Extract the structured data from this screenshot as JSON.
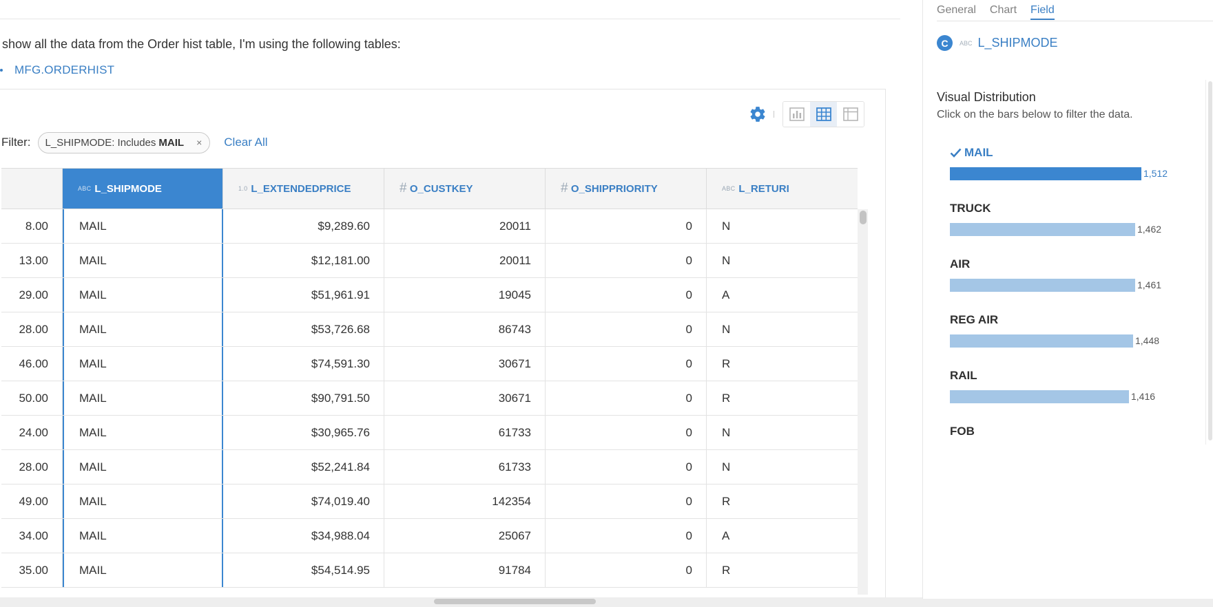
{
  "message": {
    "text": "show all the data from the Order hist table, I'm using the following tables:",
    "table_link": "MFG.ORDERHIST"
  },
  "toolbar": {
    "settings_icon": "gear-icon",
    "views": [
      "chart-view-icon",
      "table-view-icon",
      "pivot-view-icon"
    ],
    "active_view": "table"
  },
  "filter": {
    "label": "Filter:",
    "chip_field": "L_SHIPMODE: Includes",
    "chip_value": "MAIL",
    "chip_remove": "×",
    "clear_all": "Clear All"
  },
  "table": {
    "columns": [
      {
        "type": "",
        "name": ""
      },
      {
        "type": "ABC",
        "name": "L_SHIPMODE"
      },
      {
        "type": "1.0",
        "name": "L_EXTENDEDPRICE"
      },
      {
        "type": "#",
        "name": "O_CUSTKEY"
      },
      {
        "type": "#",
        "name": "O_SHIPPRIORITY"
      },
      {
        "type": "ABC",
        "name": "L_RETURI"
      }
    ],
    "rows": [
      [
        "8.00",
        "MAIL",
        "$9,289.60",
        "20011",
        "0",
        "N"
      ],
      [
        "13.00",
        "MAIL",
        "$12,181.00",
        "20011",
        "0",
        "N"
      ],
      [
        "29.00",
        "MAIL",
        "$51,961.91",
        "19045",
        "0",
        "A"
      ],
      [
        "28.00",
        "MAIL",
        "$53,726.68",
        "86743",
        "0",
        "N"
      ],
      [
        "46.00",
        "MAIL",
        "$74,591.30",
        "30671",
        "0",
        "R"
      ],
      [
        "50.00",
        "MAIL",
        "$90,791.50",
        "30671",
        "0",
        "R"
      ],
      [
        "24.00",
        "MAIL",
        "$30,965.76",
        "61733",
        "0",
        "N"
      ],
      [
        "28.00",
        "MAIL",
        "$52,241.84",
        "61733",
        "0",
        "N"
      ],
      [
        "49.00",
        "MAIL",
        "$74,019.40",
        "142354",
        "0",
        "R"
      ],
      [
        "34.00",
        "MAIL",
        "$34,988.04",
        "25067",
        "0",
        "A"
      ],
      [
        "35.00",
        "MAIL",
        "$54,514.95",
        "91784",
        "0",
        "R"
      ]
    ]
  },
  "side": {
    "tabs": [
      "General",
      "Chart",
      "Field"
    ],
    "active_tab": "Field",
    "field_badge": "C",
    "field_type": "ABC",
    "field_name": "L_SHIPMODE",
    "vd_title": "Visual Distribution",
    "vd_subtitle": "Click on the bars below to filter the data.",
    "distribution": [
      {
        "label": "MAIL",
        "count": 1512,
        "count_text": "1,512",
        "selected": true
      },
      {
        "label": "TRUCK",
        "count": 1462,
        "count_text": "1,462",
        "selected": false
      },
      {
        "label": "AIR",
        "count": 1461,
        "count_text": "1,461",
        "selected": false
      },
      {
        "label": "REG AIR",
        "count": 1448,
        "count_text": "1,448",
        "selected": false
      },
      {
        "label": "RAIL",
        "count": 1416,
        "count_text": "1,416",
        "selected": false
      },
      {
        "label": "FOB",
        "count": null,
        "count_text": "",
        "selected": false
      }
    ],
    "colors": {
      "selected_bar": "#3b86d0",
      "bar": "#a4c6e6",
      "accent": "#3a7fc4"
    }
  }
}
